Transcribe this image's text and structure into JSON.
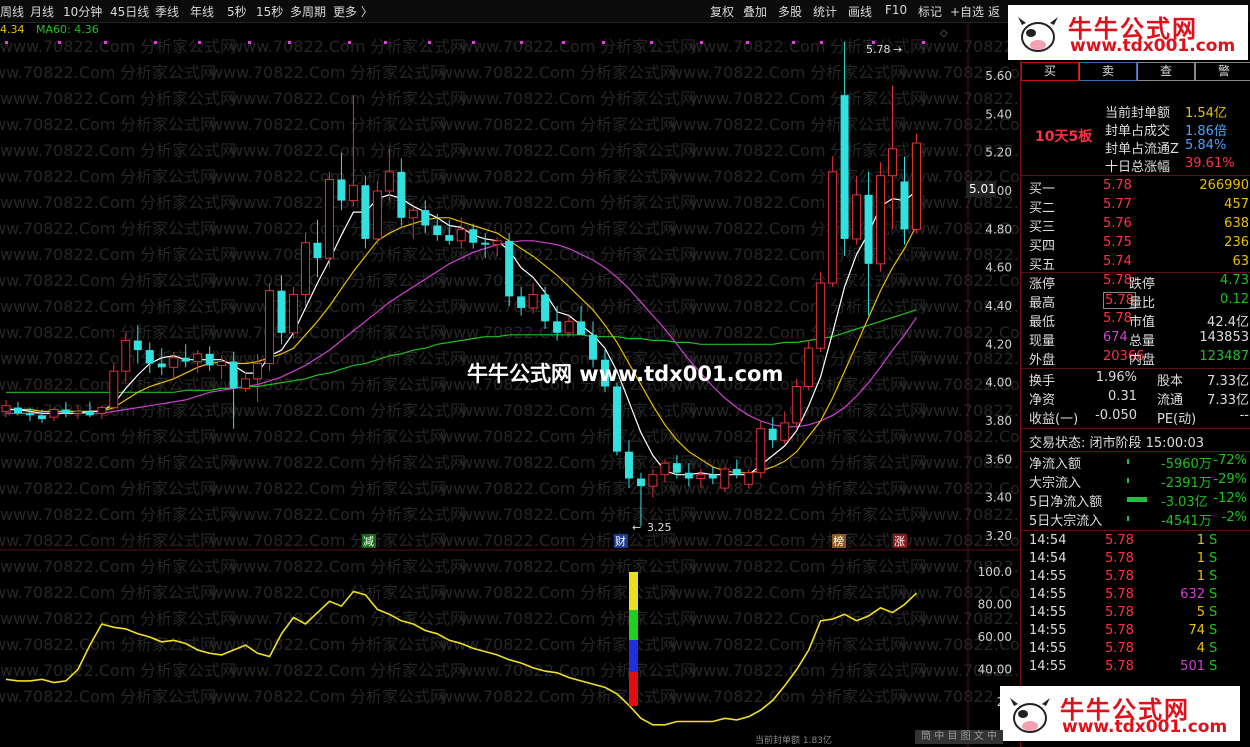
{
  "toolbar": {
    "left": [
      "周线",
      "月线",
      "10分钟",
      "45日线",
      "季线",
      "年线",
      "5秒",
      "15秒",
      "多周期",
      "更多 〉"
    ],
    "right": [
      "复权",
      "叠加",
      "多股",
      "统计",
      "画线",
      "F10",
      "标记",
      "+自选",
      "返"
    ]
  },
  "ma_legend": {
    "ma_a": "4.34",
    "ma60_label": "MA60: 4.36"
  },
  "price_axis": [
    "5.60",
    "5.40",
    "5.20",
    "5.00",
    "4.80",
    "4.60",
    "4.40",
    "4.20",
    "4.00",
    "3.80",
    "3.60",
    "3.40",
    "3.20"
  ],
  "current_price_tag": "5.01",
  "indicator_axis": [
    "100.0",
    "80.00",
    "60.00",
    "40.00",
    "20"
  ],
  "annotations": {
    "high": "5.78",
    "low": "3.25",
    "marker_jian": "减",
    "marker_cai": "财",
    "marker_bang": "榜",
    "marker_zhang": "涨"
  },
  "watermark": {
    "site": "www.70822.Com",
    "sub": "分析家公式网"
  },
  "center_watermark": "牛牛公式网 www.tdx001.com",
  "logo": {
    "name": "牛牛公式网",
    "url": "www.tdx001.com"
  },
  "bottom_status": "当前封单额 1.83亿",
  "bottom_tab": "筒 中 目 图 文 中",
  "panel": {
    "tabs": [
      "买",
      "卖",
      "查",
      "警"
    ],
    "seal_tag": "10天5板",
    "seal": [
      {
        "label": "当前封单额",
        "value": "1.54亿"
      },
      {
        "label": "封单占成交",
        "value": "1.86倍"
      },
      {
        "label": "封单占流通Z",
        "value": "5.84%"
      },
      {
        "label": "十日总涨幅",
        "value": "39.61%"
      }
    ],
    "bids": [
      {
        "label": "买一",
        "price": "5.78",
        "vol": "266990"
      },
      {
        "label": "买二",
        "price": "5.77",
        "vol": "457"
      },
      {
        "label": "买三",
        "price": "5.76",
        "vol": "638"
      },
      {
        "label": "买四",
        "price": "5.75",
        "vol": "236"
      },
      {
        "label": "买五",
        "price": "5.74",
        "vol": "63"
      }
    ],
    "quote_rows": [
      {
        "l1": "涨停",
        "v1": "5.78",
        "l2": "跌停",
        "v2": "4.73"
      },
      {
        "l1": "最高",
        "v1": "5.78",
        "l2": "量比",
        "v2": "0.12"
      },
      {
        "l1": "最低",
        "v1": "5.78",
        "l2": "市值",
        "v2": "42.4亿"
      },
      {
        "l1": "现量",
        "v1": "674",
        "l2": "总量",
        "v2": "143853"
      },
      {
        "l1": "外盘",
        "v1": "20366",
        "l2": "内盘",
        "v2": "123487"
      }
    ],
    "fund_rows": [
      {
        "l1": "换手",
        "v1": "1.96%",
        "l2": "股本",
        "v2": "7.33亿"
      },
      {
        "l1": "净资",
        "v1": "0.31",
        "l2": "流通",
        "v2": "7.33亿"
      },
      {
        "l1": "收益(一)",
        "v1": "-0.050",
        "l2": "PE(动)",
        "v2": "--"
      }
    ],
    "trade_status": "交易状态: 闭市阶段 15:00:03",
    "flows": [
      {
        "label": "净流入额",
        "value": "-5960万",
        "pct": "-72%",
        "bar": 0.03
      },
      {
        "label": "大宗流入",
        "value": "-2391万",
        "pct": "-29%",
        "bar": 0.01
      },
      {
        "label": "5日净流入额",
        "value": "-3.03亿",
        "pct": "-12%",
        "bar": 0.9
      },
      {
        "label": "5日大宗流入",
        "value": "-4541万",
        "pct": "-2%",
        "bar": 0.03
      }
    ],
    "ticks": [
      {
        "time": "14:54",
        "price": "5.78",
        "vol": "1",
        "side": "S"
      },
      {
        "time": "14:54",
        "price": "5.78",
        "vol": "1",
        "side": "S"
      },
      {
        "time": "14:55",
        "price": "5.78",
        "vol": "1",
        "side": "S"
      },
      {
        "time": "14:55",
        "price": "5.78",
        "vol": "632",
        "side": "S"
      },
      {
        "time": "14:55",
        "price": "5.78",
        "vol": "5",
        "side": "S"
      },
      {
        "time": "14:55",
        "price": "5.78",
        "vol": "74",
        "side": "S"
      },
      {
        "time": "14:55",
        "price": "5.78",
        "vol": "4",
        "side": "S"
      },
      {
        "time": "14:55",
        "price": "5.78",
        "vol": "501",
        "side": "S"
      }
    ]
  },
  "colors": {
    "up": "#e0303a",
    "down": "#33e0e0",
    "ma5": "#ffffff",
    "ma10": "#e8c000",
    "ma20": "#d040d0",
    "ma60": "#20c020",
    "indicator": "#f0e020"
  },
  "chart_data": {
    "type": "candlestick",
    "y_range": [
      3.2,
      5.78
    ],
    "candles": [
      {
        "o": 3.85,
        "h": 3.91,
        "l": 3.82,
        "c": 3.88
      },
      {
        "o": 3.87,
        "h": 3.9,
        "l": 3.83,
        "c": 3.84
      },
      {
        "o": 3.84,
        "h": 3.87,
        "l": 3.8,
        "c": 3.83
      },
      {
        "o": 3.83,
        "h": 3.86,
        "l": 3.79,
        "c": 3.81
      },
      {
        "o": 3.82,
        "h": 3.87,
        "l": 3.8,
        "c": 3.86
      },
      {
        "o": 3.86,
        "h": 3.9,
        "l": 3.82,
        "c": 3.84
      },
      {
        "o": 3.84,
        "h": 3.88,
        "l": 3.81,
        "c": 3.85
      },
      {
        "o": 3.85,
        "h": 3.9,
        "l": 3.82,
        "c": 3.83
      },
      {
        "o": 3.84,
        "h": 3.88,
        "l": 3.81,
        "c": 3.87
      },
      {
        "o": 3.87,
        "h": 4.1,
        "l": 3.86,
        "c": 4.06
      },
      {
        "o": 4.06,
        "h": 4.26,
        "l": 4.0,
        "c": 4.22
      },
      {
        "o": 4.22,
        "h": 4.3,
        "l": 4.1,
        "c": 4.17
      },
      {
        "o": 4.17,
        "h": 4.21,
        "l": 4.05,
        "c": 4.1
      },
      {
        "o": 4.1,
        "h": 4.18,
        "l": 4.04,
        "c": 4.08
      },
      {
        "o": 4.08,
        "h": 4.16,
        "l": 4.02,
        "c": 4.13
      },
      {
        "o": 4.13,
        "h": 4.2,
        "l": 4.08,
        "c": 4.11
      },
      {
        "o": 4.11,
        "h": 4.17,
        "l": 4.05,
        "c": 4.15
      },
      {
        "o": 4.15,
        "h": 4.19,
        "l": 4.06,
        "c": 4.09
      },
      {
        "o": 4.09,
        "h": 4.14,
        "l": 4.02,
        "c": 4.11
      },
      {
        "o": 4.11,
        "h": 4.16,
        "l": 3.76,
        "c": 3.97
      },
      {
        "o": 3.97,
        "h": 4.06,
        "l": 3.95,
        "c": 4.02
      },
      {
        "o": 4.02,
        "h": 4.15,
        "l": 3.9,
        "c": 4.1
      },
      {
        "o": 4.1,
        "h": 4.52,
        "l": 4.06,
        "c": 4.48
      },
      {
        "o": 4.48,
        "h": 4.56,
        "l": 4.2,
        "c": 4.26
      },
      {
        "o": 4.26,
        "h": 4.5,
        "l": 4.23,
        "c": 4.46
      },
      {
        "o": 4.46,
        "h": 4.78,
        "l": 4.4,
        "c": 4.73
      },
      {
        "o": 4.73,
        "h": 4.85,
        "l": 4.55,
        "c": 4.65
      },
      {
        "o": 4.65,
        "h": 5.1,
        "l": 4.6,
        "c": 5.06
      },
      {
        "o": 5.06,
        "h": 5.2,
        "l": 4.9,
        "c": 4.95
      },
      {
        "o": 4.95,
        "h": 5.5,
        "l": 4.92,
        "c": 5.03
      },
      {
        "o": 5.03,
        "h": 5.08,
        "l": 4.7,
        "c": 4.75
      },
      {
        "o": 4.75,
        "h": 5.05,
        "l": 4.72,
        "c": 5.0
      },
      {
        "o": 5.0,
        "h": 5.22,
        "l": 4.95,
        "c": 5.1
      },
      {
        "o": 5.1,
        "h": 5.17,
        "l": 4.82,
        "c": 4.86
      },
      {
        "o": 4.86,
        "h": 4.92,
        "l": 4.75,
        "c": 4.9
      },
      {
        "o": 4.9,
        "h": 4.95,
        "l": 4.78,
        "c": 4.82
      },
      {
        "o": 4.82,
        "h": 4.88,
        "l": 4.74,
        "c": 4.77
      },
      {
        "o": 4.77,
        "h": 4.85,
        "l": 4.72,
        "c": 4.74
      },
      {
        "o": 4.74,
        "h": 4.86,
        "l": 4.7,
        "c": 4.8
      },
      {
        "o": 4.8,
        "h": 4.83,
        "l": 4.7,
        "c": 4.73
      },
      {
        "o": 4.73,
        "h": 4.78,
        "l": 4.65,
        "c": 4.72
      },
      {
        "o": 4.72,
        "h": 4.76,
        "l": 4.66,
        "c": 4.74
      },
      {
        "o": 4.74,
        "h": 4.78,
        "l": 4.4,
        "c": 4.45
      },
      {
        "o": 4.45,
        "h": 4.5,
        "l": 4.35,
        "c": 4.39
      },
      {
        "o": 4.39,
        "h": 4.52,
        "l": 4.36,
        "c": 4.46
      },
      {
        "o": 4.46,
        "h": 4.5,
        "l": 4.28,
        "c": 4.32
      },
      {
        "o": 4.32,
        "h": 4.4,
        "l": 4.22,
        "c": 4.26
      },
      {
        "o": 4.26,
        "h": 4.35,
        "l": 4.24,
        "c": 4.32
      },
      {
        "o": 4.32,
        "h": 4.4,
        "l": 4.28,
        "c": 4.25
      },
      {
        "o": 4.25,
        "h": 4.32,
        "l": 4.08,
        "c": 4.12
      },
      {
        "o": 4.12,
        "h": 4.18,
        "l": 3.95,
        "c": 3.98
      },
      {
        "o": 3.98,
        "h": 4.0,
        "l": 3.62,
        "c": 3.64
      },
      {
        "o": 3.64,
        "h": 3.7,
        "l": 3.45,
        "c": 3.5
      },
      {
        "o": 3.5,
        "h": 3.53,
        "l": 3.25,
        "c": 3.46
      },
      {
        "o": 3.46,
        "h": 3.55,
        "l": 3.4,
        "c": 3.52
      },
      {
        "o": 3.52,
        "h": 3.6,
        "l": 3.48,
        "c": 3.58
      },
      {
        "o": 3.58,
        "h": 3.62,
        "l": 3.5,
        "c": 3.53
      },
      {
        "o": 3.53,
        "h": 3.58,
        "l": 3.46,
        "c": 3.5
      },
      {
        "o": 3.5,
        "h": 3.55,
        "l": 3.45,
        "c": 3.52
      },
      {
        "o": 3.52,
        "h": 3.56,
        "l": 3.47,
        "c": 3.5
      },
      {
        "o": 3.45,
        "h": 3.56,
        "l": 3.43,
        "c": 3.55
      },
      {
        "o": 3.55,
        "h": 3.6,
        "l": 3.5,
        "c": 3.52
      },
      {
        "o": 3.47,
        "h": 3.55,
        "l": 3.45,
        "c": 3.53
      },
      {
        "o": 3.53,
        "h": 3.8,
        "l": 3.5,
        "c": 3.76
      },
      {
        "o": 3.76,
        "h": 3.82,
        "l": 3.66,
        "c": 3.7
      },
      {
        "o": 3.7,
        "h": 3.85,
        "l": 3.68,
        "c": 3.79
      },
      {
        "o": 3.79,
        "h": 4.02,
        "l": 3.76,
        "c": 3.98
      },
      {
        "o": 3.98,
        "h": 4.22,
        "l": 3.96,
        "c": 4.18
      },
      {
        "o": 4.18,
        "h": 4.58,
        "l": 4.16,
        "c": 4.52
      },
      {
        "o": 4.52,
        "h": 5.18,
        "l": 4.5,
        "c": 5.1
      },
      {
        "o": 5.5,
        "h": 5.78,
        "l": 4.66,
        "c": 4.75
      },
      {
        "o": 4.75,
        "h": 5.08,
        "l": 4.72,
        "c": 4.98
      },
      {
        "o": 4.98,
        "h": 5.1,
        "l": 4.35,
        "c": 4.62
      },
      {
        "o": 4.62,
        "h": 5.15,
        "l": 4.58,
        "c": 5.08
      },
      {
        "o": 5.08,
        "h": 5.55,
        "l": 4.8,
        "c": 5.22
      },
      {
        "o": 5.05,
        "h": 5.18,
        "l": 4.72,
        "c": 4.8
      },
      {
        "o": 4.8,
        "h": 5.3,
        "l": 4.78,
        "c": 5.25
      }
    ],
    "ma5": [
      3.86,
      3.86,
      3.85,
      3.84,
      3.84,
      3.84,
      3.84,
      3.85,
      3.85,
      3.89,
      3.97,
      4.04,
      4.1,
      4.13,
      4.14,
      4.12,
      4.12,
      4.12,
      4.12,
      4.09,
      4.05,
      4.05,
      4.14,
      4.17,
      4.26,
      4.39,
      4.52,
      4.64,
      4.77,
      4.89,
      4.89,
      4.96,
      4.98,
      4.96,
      4.92,
      4.89,
      4.86,
      4.82,
      4.81,
      4.77,
      4.75,
      4.74,
      4.69,
      4.6,
      4.55,
      4.47,
      4.37,
      4.35,
      4.3,
      4.25,
      4.18,
      4.06,
      3.9,
      3.74,
      3.62,
      3.54,
      3.52,
      3.52,
      3.53,
      3.52,
      3.52,
      3.52,
      3.52,
      3.57,
      3.62,
      3.67,
      3.75,
      3.88,
      4.03,
      4.26,
      4.5,
      4.67,
      4.78,
      4.92,
      4.96,
      4.95,
      5.0
    ],
    "ma10": [
      3.86,
      3.86,
      3.86,
      3.85,
      3.85,
      3.85,
      3.85,
      3.85,
      3.85,
      3.87,
      3.91,
      3.95,
      3.98,
      4.0,
      4.02,
      4.05,
      4.08,
      4.1,
      4.11,
      4.1,
      4.1,
      4.11,
      4.13,
      4.15,
      4.18,
      4.25,
      4.32,
      4.4,
      4.49,
      4.58,
      4.66,
      4.74,
      4.78,
      4.81,
      4.83,
      4.85,
      4.86,
      4.86,
      4.84,
      4.82,
      4.8,
      4.78,
      4.74,
      4.7,
      4.66,
      4.61,
      4.56,
      4.5,
      4.44,
      4.38,
      4.3,
      4.21,
      4.1,
      3.99,
      3.88,
      3.78,
      3.7,
      3.64,
      3.6,
      3.56,
      3.54,
      3.53,
      3.53,
      3.54,
      3.56,
      3.59,
      3.64,
      3.72,
      3.8,
      3.92,
      4.06,
      4.2,
      4.34,
      4.48,
      4.6,
      4.7,
      4.82
    ],
    "ma20": [
      3.84,
      3.84,
      3.84,
      3.84,
      3.84,
      3.84,
      3.84,
      3.84,
      3.84,
      3.85,
      3.86,
      3.87,
      3.88,
      3.89,
      3.9,
      3.91,
      3.93,
      3.95,
      3.96,
      3.97,
      3.98,
      3.99,
      4.01,
      4.03,
      4.06,
      4.09,
      4.13,
      4.17,
      4.22,
      4.27,
      4.32,
      4.37,
      4.42,
      4.46,
      4.5,
      4.54,
      4.58,
      4.62,
      4.65,
      4.68,
      4.7,
      4.72,
      4.73,
      4.74,
      4.74,
      4.73,
      4.72,
      4.7,
      4.67,
      4.64,
      4.6,
      4.55,
      4.49,
      4.42,
      4.35,
      4.28,
      4.2,
      4.12,
      4.05,
      3.98,
      3.92,
      3.87,
      3.83,
      3.8,
      3.78,
      3.77,
      3.77,
      3.78,
      3.8,
      3.83,
      3.87,
      3.93,
      4.0,
      4.08,
      4.17,
      4.25,
      4.34
    ],
    "ma60": [
      3.95,
      3.95,
      3.95,
      3.95,
      3.95,
      3.95,
      3.95,
      3.95,
      3.95,
      3.95,
      3.95,
      3.95,
      3.95,
      3.95,
      3.95,
      3.96,
      3.96,
      3.96,
      3.97,
      3.97,
      3.98,
      3.98,
      3.99,
      4.0,
      4.01,
      4.02,
      4.04,
      4.05,
      4.07,
      4.09,
      4.1,
      4.12,
      4.14,
      4.15,
      4.17,
      4.18,
      4.2,
      4.21,
      4.22,
      4.23,
      4.24,
      4.24,
      4.25,
      4.25,
      4.25,
      4.25,
      4.25,
      4.25,
      4.25,
      4.24,
      4.24,
      4.24,
      4.23,
      4.23,
      4.22,
      4.22,
      4.21,
      4.21,
      4.2,
      4.2,
      4.2,
      4.2,
      4.2,
      4.2,
      4.2,
      4.21,
      4.21,
      4.22,
      4.23,
      4.24,
      4.26,
      4.28,
      4.3,
      4.32,
      4.34,
      4.36,
      4.38
    ],
    "indicator": [
      34,
      33,
      33,
      34,
      32,
      33,
      40,
      55,
      68,
      66,
      65,
      62,
      60,
      57,
      58,
      56,
      52,
      50,
      49,
      52,
      55,
      50,
      48,
      62,
      72,
      68,
      75,
      82,
      79,
      88,
      86,
      77,
      74,
      70,
      68,
      64,
      62,
      58,
      56,
      53,
      51,
      49,
      46,
      44,
      41,
      39,
      38,
      35,
      33,
      31,
      29,
      25,
      18,
      10,
      6,
      6,
      8,
      8,
      8,
      8,
      10,
      9,
      11,
      15,
      21,
      30,
      40,
      52,
      70,
      71,
      74,
      70,
      73,
      78,
      75,
      80,
      87
    ]
  }
}
